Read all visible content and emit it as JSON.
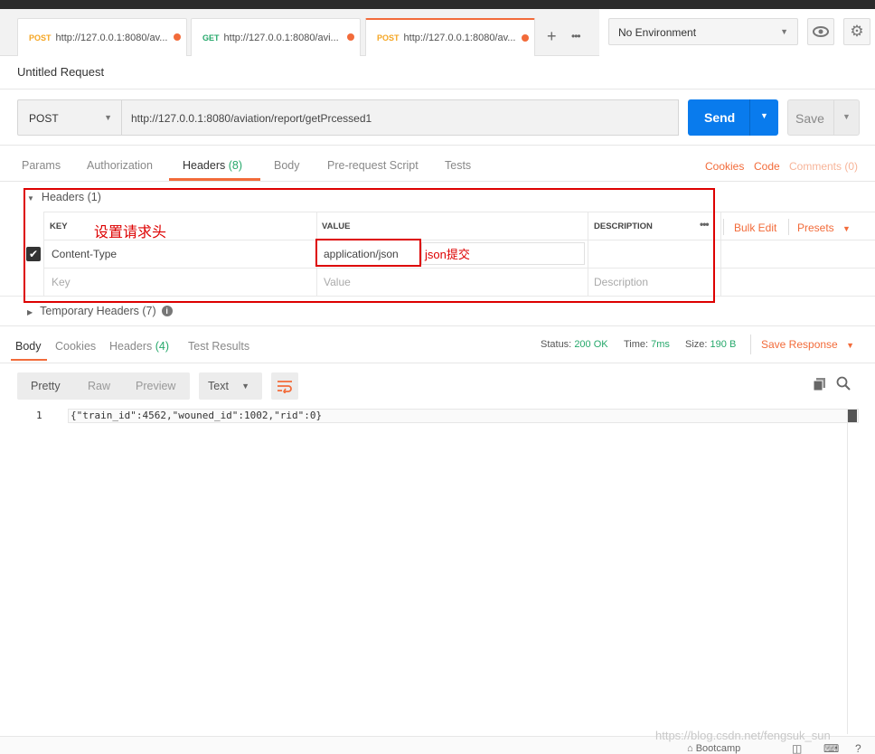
{
  "tabs": [
    {
      "method": "POST",
      "url": "http://127.0.0.1:8080/av..."
    },
    {
      "method": "GET",
      "url": "http://127.0.0.1:8080/avi..."
    },
    {
      "method": "POST",
      "url": "http://127.0.0.1:8080/av..."
    }
  ],
  "tab_actions": {
    "add": "+",
    "more": "•••"
  },
  "environment": {
    "selected": "No Environment"
  },
  "request": {
    "title": "Untitled Request",
    "method": "POST",
    "url": "http://127.0.0.1:8080/aviation/report/getPrcessed1",
    "send_label": "Send",
    "save_label": "Save"
  },
  "request_tabs": {
    "params": "Params",
    "authorization": "Authorization",
    "headers": "Headers",
    "headers_count": "(8)",
    "body": "Body",
    "prerequest": "Pre-request Script",
    "tests": "Tests"
  },
  "request_links": {
    "cookies": "Cookies",
    "code": "Code",
    "comments": "Comments (0)"
  },
  "headers_section": {
    "title": "Headers (1)",
    "col_key": "KEY",
    "col_value": "VALUE",
    "col_description": "DESCRIPTION",
    "more": "•••",
    "bulk_edit": "Bulk Edit",
    "presets": "Presets",
    "rows": [
      {
        "key": "Content-Type",
        "value": "application/json",
        "description": ""
      }
    ],
    "placeholder": {
      "key": "Key",
      "value": "Value",
      "description": "Description"
    }
  },
  "temporary_headers": {
    "title": "Temporary Headers (7)",
    "info": "i"
  },
  "annotations": {
    "set_header": "设置请求头",
    "json_submit": "json提交"
  },
  "response_tabs": {
    "body": "Body",
    "cookies": "Cookies",
    "headers": "Headers",
    "headers_count": "(4)",
    "test_results": "Test Results"
  },
  "response_status": {
    "status_label": "Status:",
    "status_value": "200 OK",
    "time_label": "Time:",
    "time_value": "7ms",
    "size_label": "Size:",
    "size_value": "190 B",
    "save_response": "Save Response"
  },
  "view_modes": {
    "pretty": "Pretty",
    "raw": "Raw",
    "preview": "Preview",
    "format": "Text"
  },
  "response_body": {
    "line_number": "1",
    "content": "{\"train_id\":4562,\"wouned_id\":1002,\"rid\":0}"
  },
  "footer": {
    "bootcamp": "Bootcamp"
  },
  "watermark": "https://blog.csdn.net/fengsuk_sun",
  "colors": {
    "accent": "#f26b3a",
    "send": "#097bed",
    "success": "#26a86b",
    "annotation": "#dd0000"
  }
}
